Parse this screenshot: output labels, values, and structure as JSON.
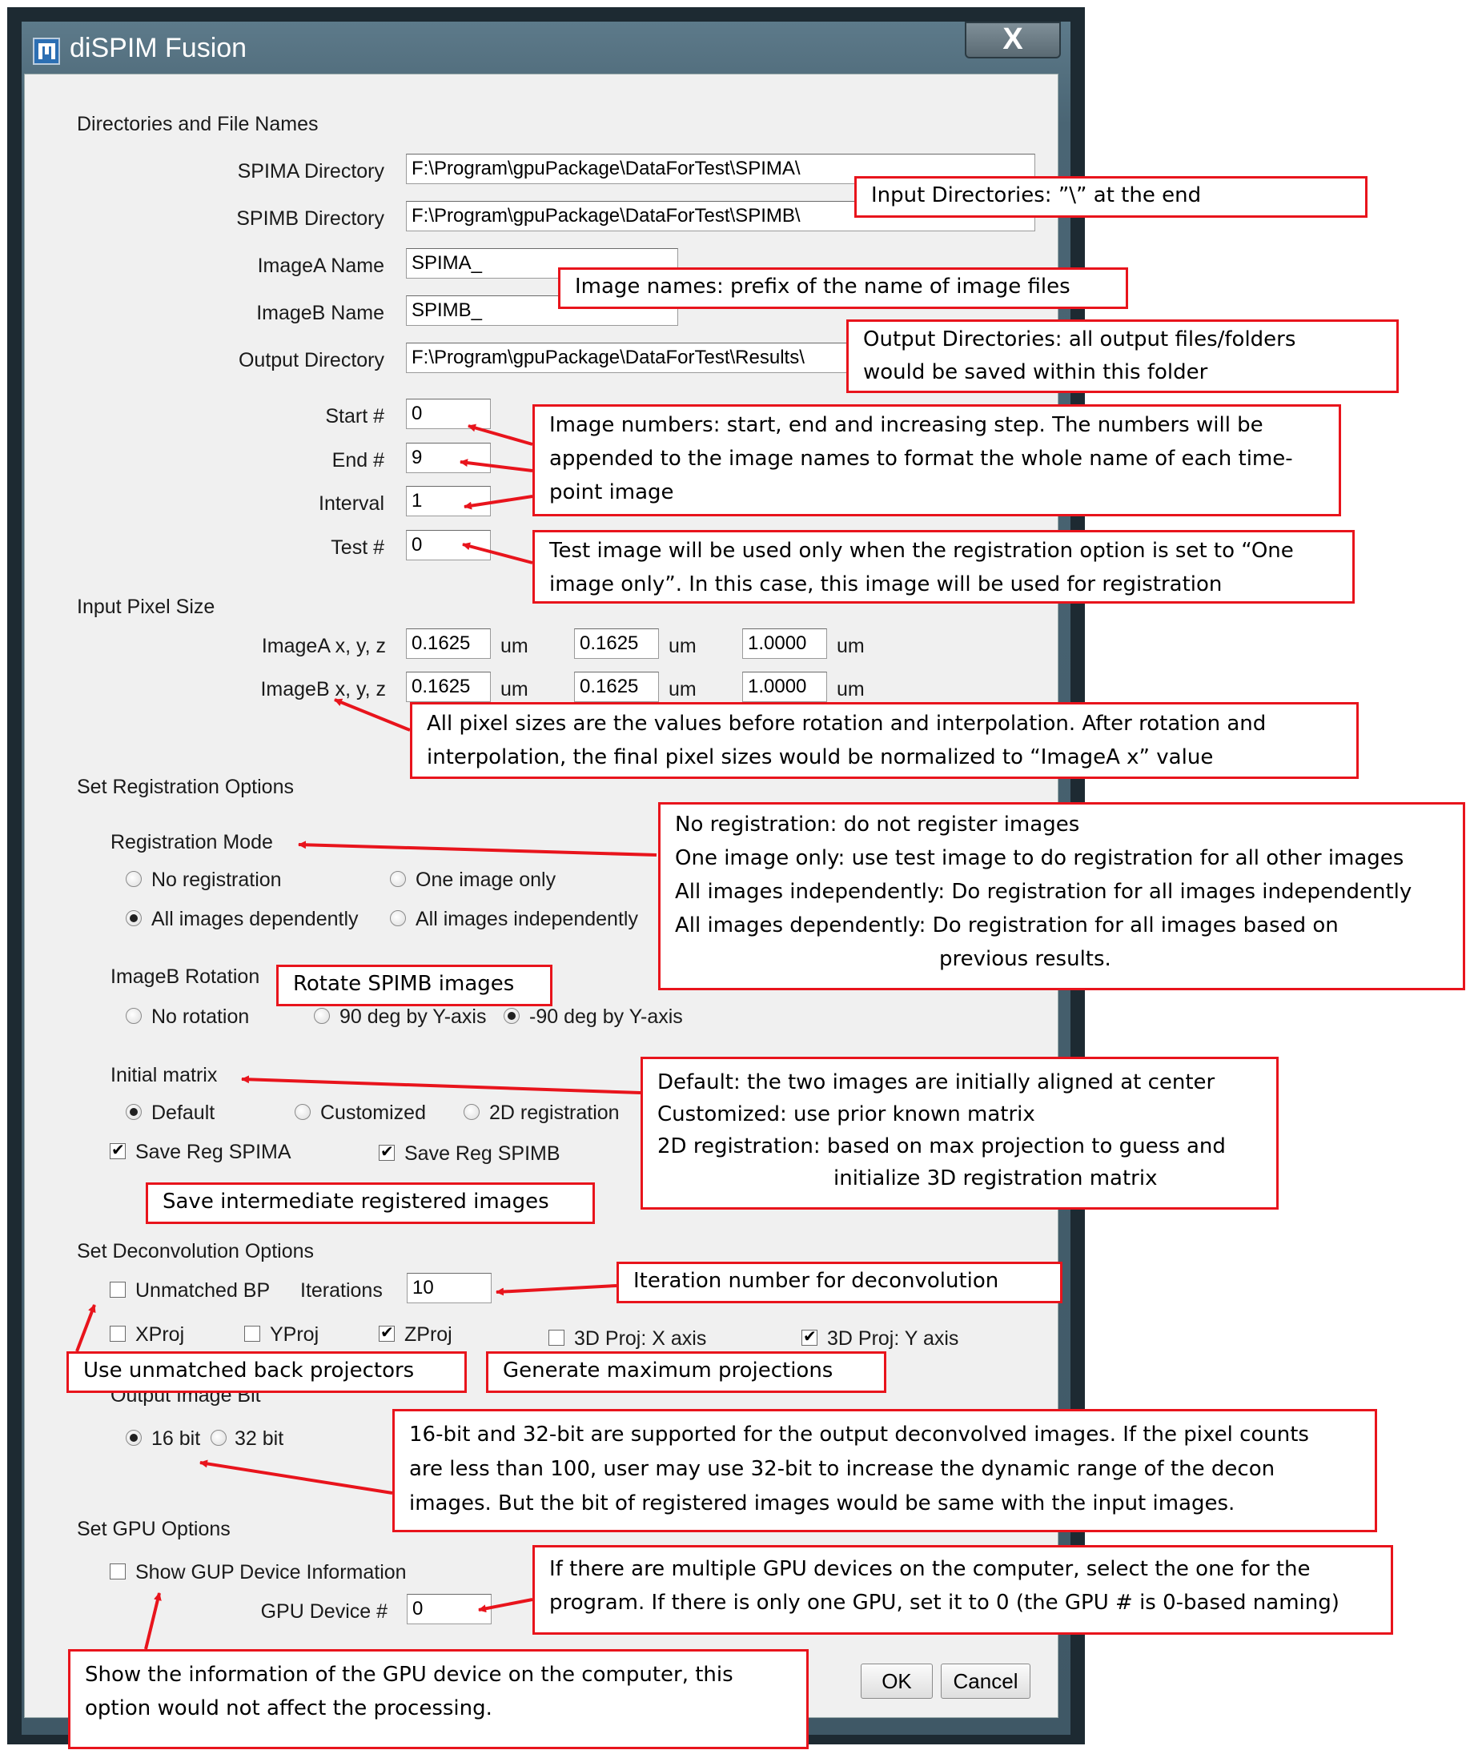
{
  "window": {
    "title": "diSPIM Fusion",
    "close_label": "X"
  },
  "sections": {
    "dirs": "Directories and File Names",
    "pixel": "Input Pixel Size",
    "registration": "Set Registration Options",
    "deconvolution": "Set Deconvolution Options",
    "gpu": "Set GPU Options"
  },
  "fields": {
    "spima_dir": {
      "label": "SPIMA Directory",
      "value": "F:\\Program\\gpuPackage\\DataForTest\\SPIMA\\"
    },
    "spimb_dir": {
      "label": "SPIMB Directory",
      "value": "F:\\Program\\gpuPackage\\DataForTest\\SPIMB\\"
    },
    "imagea_name": {
      "label": "ImageA Name",
      "value": "SPIMA_"
    },
    "imageb_name": {
      "label": "ImageB Name",
      "value": "SPIMB_"
    },
    "output_dir": {
      "label": "Output Directory",
      "value": "F:\\Program\\gpuPackage\\DataForTest\\Results\\"
    },
    "start": {
      "label": "Start #",
      "value": "0"
    },
    "end": {
      "label": "End #",
      "value": "9"
    },
    "interval": {
      "label": "Interval",
      "value": "1"
    },
    "test": {
      "label": "Test #",
      "value": "0"
    }
  },
  "pixel": {
    "imagea_label": "ImageA x, y, z",
    "imageb_label": "ImageB x, y, z",
    "unit": "um",
    "imagea": [
      "0.1625",
      "0.1625",
      "1.0000"
    ],
    "imageb": [
      "0.1625",
      "0.1625",
      "1.0000"
    ]
  },
  "registration": {
    "mode_label": "Registration Mode",
    "modes": [
      "No registration",
      "One image only",
      "All images dependently",
      "All images independently"
    ],
    "selected_mode": "All images dependently",
    "rotation_label": "ImageB Rotation",
    "rotations": [
      "No rotation",
      "90 deg by Y-axis",
      "-90 deg by Y-axis"
    ],
    "selected_rotation": "-90 deg by Y-axis",
    "matrix_label": "Initial matrix",
    "matrices": [
      "Default",
      "Customized",
      "2D registration"
    ],
    "selected_matrix": "Default",
    "save_spima": "Save Reg SPIMA",
    "save_spimb": "Save Reg SPIMB"
  },
  "deconvolution": {
    "unmatched_bp": "Unmatched BP",
    "iterations_label": "Iterations",
    "iterations": "10",
    "xproj": "XProj",
    "yproj": "YProj",
    "zproj": "ZProj",
    "proj3d_x": "3D Proj: X axis",
    "proj3d_y": "3D Proj: Y axis",
    "bit_label": "Output Image Bit",
    "bit16": "16 bit",
    "bit32": "32 bit",
    "selected_bit": "16 bit"
  },
  "gpu": {
    "show_info": "Show GUP Device Information",
    "device_label": "GPU Device #",
    "device": "0"
  },
  "buttons": {
    "ok": "OK",
    "cancel": "Cancel"
  },
  "annotations": {
    "input_dirs": "Input Directories: ”\\” at the end",
    "image_names": "Image names: prefix of the name of image files",
    "output_dirs": [
      "Output Directories: all output files/folders",
      "would be saved within this folder"
    ],
    "image_numbers": [
      "Image numbers: start, end and increasing step. The numbers will be",
      "appended to the image names to format the whole name of each time-",
      "point image"
    ],
    "test_image": [
      "Test image will be used only when the registration option is set to “One",
      "image only”. In this case, this image will be used for registration"
    ],
    "pixel_sizes": [
      "All pixel sizes are the values before rotation and interpolation. After rotation and",
      "interpolation, the final pixel sizes would be normalized to “ImageA x” value"
    ],
    "reg_modes": [
      "No registration: do not register images",
      "One image only: use test image to do registration for all other images",
      "All images independently: Do registration for all images independently",
      "All images dependently: Do registration for all images based on",
      "previous results."
    ],
    "rotate": "Rotate SPIMB images",
    "initial_matrix": [
      "Default: the two images are initially aligned at center",
      "Customized: use prior known matrix",
      "2D registration:  based on max projection to guess and",
      "initialize 3D registration matrix"
    ],
    "save_intermediate": "Save intermediate registered images",
    "iteration_number": "Iteration number for deconvolution",
    "unmatched": "Use unmatched back projectors",
    "max_proj": "Generate maximum projections",
    "bits": [
      "16-bit and 32-bit are supported for the output deconvolved images. If the pixel counts",
      "are less than 100, user may use 32-bit to increase the dynamic range of the decon",
      "images. But the bit of registered images would be same with the input images."
    ],
    "gpu_select": [
      "If there are multiple GPU devices on the computer, select the one for the",
      "program. If there is only one GPU, set it to 0 (the GPU # is 0-based naming)"
    ],
    "gpu_info": [
      "Show the information of the GPU device on the computer, this",
      "option would not affect the processing."
    ]
  },
  "colors": {
    "annotation_border": "#e8141c",
    "panel": "#f0f0f0",
    "frame": "#4a6574"
  }
}
